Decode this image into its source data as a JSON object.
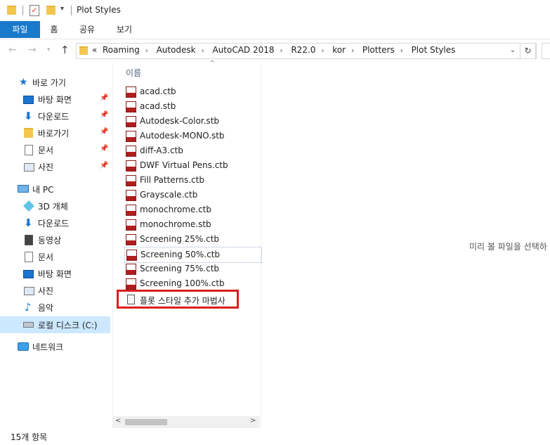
{
  "window": {
    "title": "Plot Styles"
  },
  "ribbon": {
    "tabs": [
      "파일",
      "홈",
      "공유",
      "보기"
    ]
  },
  "addressbar": {
    "prefix": "«",
    "crumbs": [
      "Roaming",
      "Autodesk",
      "AutoCAD 2018",
      "R22.0",
      "kor",
      "Plotters",
      "Plot Styles"
    ]
  },
  "sidebar": {
    "quick_access": "바로 가기",
    "quick_items": [
      "바탕 화면",
      "다운로드",
      "바로가기",
      "문서",
      "사진"
    ],
    "this_pc": "내 PC",
    "pc_items": [
      "3D 개체",
      "다운로드",
      "동영상",
      "문서",
      "바탕 화면",
      "사진",
      "음악",
      "로컬 디스크 (C:)"
    ],
    "network": "네트워크"
  },
  "filelist": {
    "column_name": "이름",
    "files": [
      "acad.ctb",
      "acad.stb",
      "Autodesk-Color.stb",
      "Autodesk-MONO.stb",
      "diff-A3.ctb",
      "DWF Virtual Pens.ctb",
      "Fill Patterns.ctb",
      "Grayscale.ctb",
      "monochrome.ctb",
      "monochrome.stb",
      "Screening 25%.ctb",
      "Screening 50%.ctb",
      "Screening 75%.ctb",
      "Screening 100%.ctb"
    ],
    "wizard": "플롯 스타일 추가 마법사"
  },
  "preview": {
    "message": "미리 볼 파일을 선택하"
  },
  "status": {
    "count": "15개 항목"
  },
  "colors": {
    "accent": "#1979ca",
    "highlight": "#d81f1f",
    "selected_nav": "#cce8ff"
  }
}
